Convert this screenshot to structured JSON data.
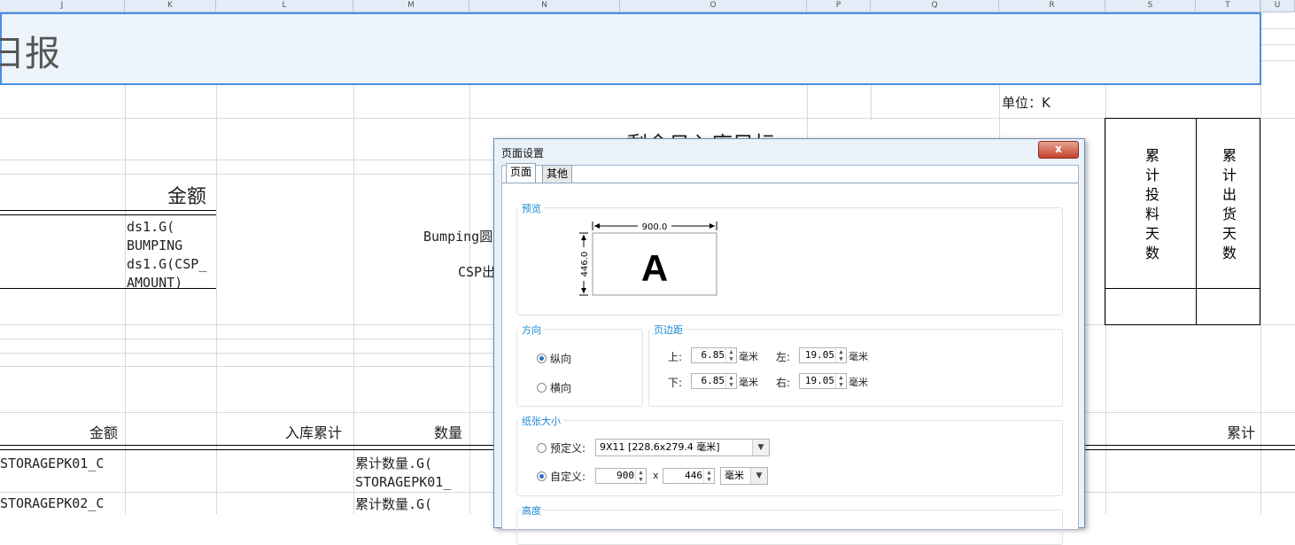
{
  "sheet": {
    "columns": [
      "J",
      "K",
      "L",
      "M",
      "N",
      "O",
      "P",
      "Q",
      "R",
      "S",
      "T",
      "U"
    ],
    "title_fragment": "日报",
    "unit_label": "单位：K",
    "remaining_target": "剩余日入库目标:",
    "amount_header": "金额",
    "formula_bumping_1": "ds1.G(",
    "formula_bumping_2": "BUMPING",
    "formula_csp_1": "ds1.G(CSP_",
    "formula_csp_2": "AMOUNT)",
    "bumping_label": "Bumping圆",
    "csp_label": "CSP出",
    "vertical_header_1": [
      "累",
      "计",
      "投",
      "料",
      "天",
      "数"
    ],
    "vertical_header_2": [
      "累",
      "计",
      "出",
      "货",
      "天",
      "数"
    ],
    "row_amount": "金额",
    "row_in_total": "入库累计",
    "row_qty": "数量",
    "row_cumulative": "累计",
    "storage_1": "STORAGEPK01_C",
    "storage_2": "STORAGEPK02_C",
    "cum_qty_1a": "累计数量.G(",
    "cum_qty_1b": "STORAGEPK01_",
    "cum_qty_2a": "累计数量.G("
  },
  "dialog": {
    "title": "页面设置",
    "close_label": "x",
    "tabs": [
      "页面",
      "其他"
    ],
    "preview": {
      "label": "预览",
      "width_value": "900.0",
      "height_value": "446.0",
      "letter": "A"
    },
    "orientation": {
      "label": "方向",
      "portrait": "纵向",
      "landscape": "横向",
      "selected": "纵向"
    },
    "margins": {
      "label": "页边距",
      "top_label": "上:",
      "top_value": "6.85",
      "bottom_label": "下:",
      "bottom_value": "6.85",
      "left_label": "左:",
      "left_value": "19.05",
      "right_label": "右:",
      "right_value": "19.05",
      "unit": "毫米"
    },
    "paper": {
      "label": "纸张大小",
      "predefined_label": "预定义:",
      "predefined_value": "9X11 [228.6x279.4 毫米]",
      "custom_label": "自定义:",
      "width": "900",
      "x": "x",
      "height": "446",
      "unit": "毫米",
      "selected": "自定义"
    },
    "next_group_label": "高度"
  },
  "colors": {
    "selection_border": "#4a8fe0",
    "selection_fill": "#eef4fb",
    "dialog_frame": "#e9f1f9",
    "group_label": "#1a88d4",
    "close_button": "#c4412b"
  }
}
